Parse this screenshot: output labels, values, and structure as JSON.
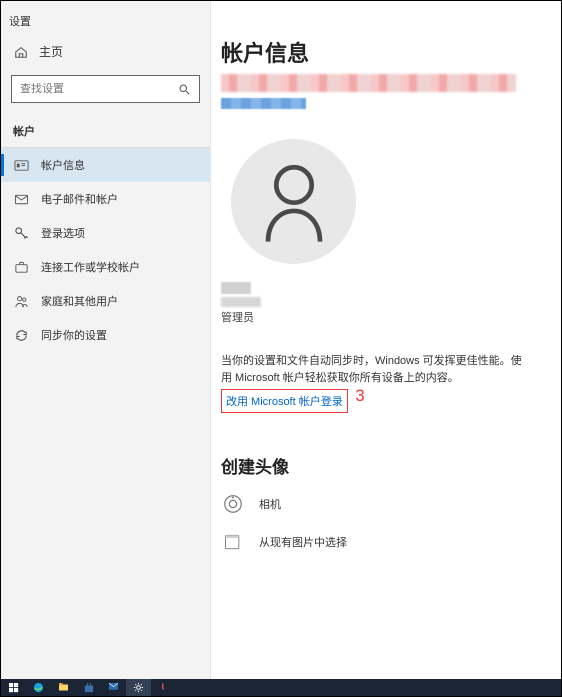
{
  "window": {
    "title": "设置"
  },
  "sidebar": {
    "home": "主页",
    "search_placeholder": "查找设置",
    "section": "帐户",
    "items": [
      {
        "label": "帐户信息"
      },
      {
        "label": "电子邮件和帐户"
      },
      {
        "label": "登录选项"
      },
      {
        "label": "连接工作或学校帐户"
      },
      {
        "label": "家庭和其他用户"
      },
      {
        "label": "同步你的设置"
      }
    ]
  },
  "main": {
    "heading": "帐户信息",
    "admin_role": "管理员",
    "sync_text": "当你的设置和文件自动同步时，Windows 可发挥更佳性能。使用 Microsoft 帐户轻松获取你所有设备上的内容。",
    "ms_login_link": "改用 Microsoft 帐户登录",
    "create_avatar": "创建头像",
    "options": [
      {
        "label": "相机"
      },
      {
        "label": "从现有图片中选择"
      }
    ]
  },
  "annotation": {
    "number": "3"
  }
}
